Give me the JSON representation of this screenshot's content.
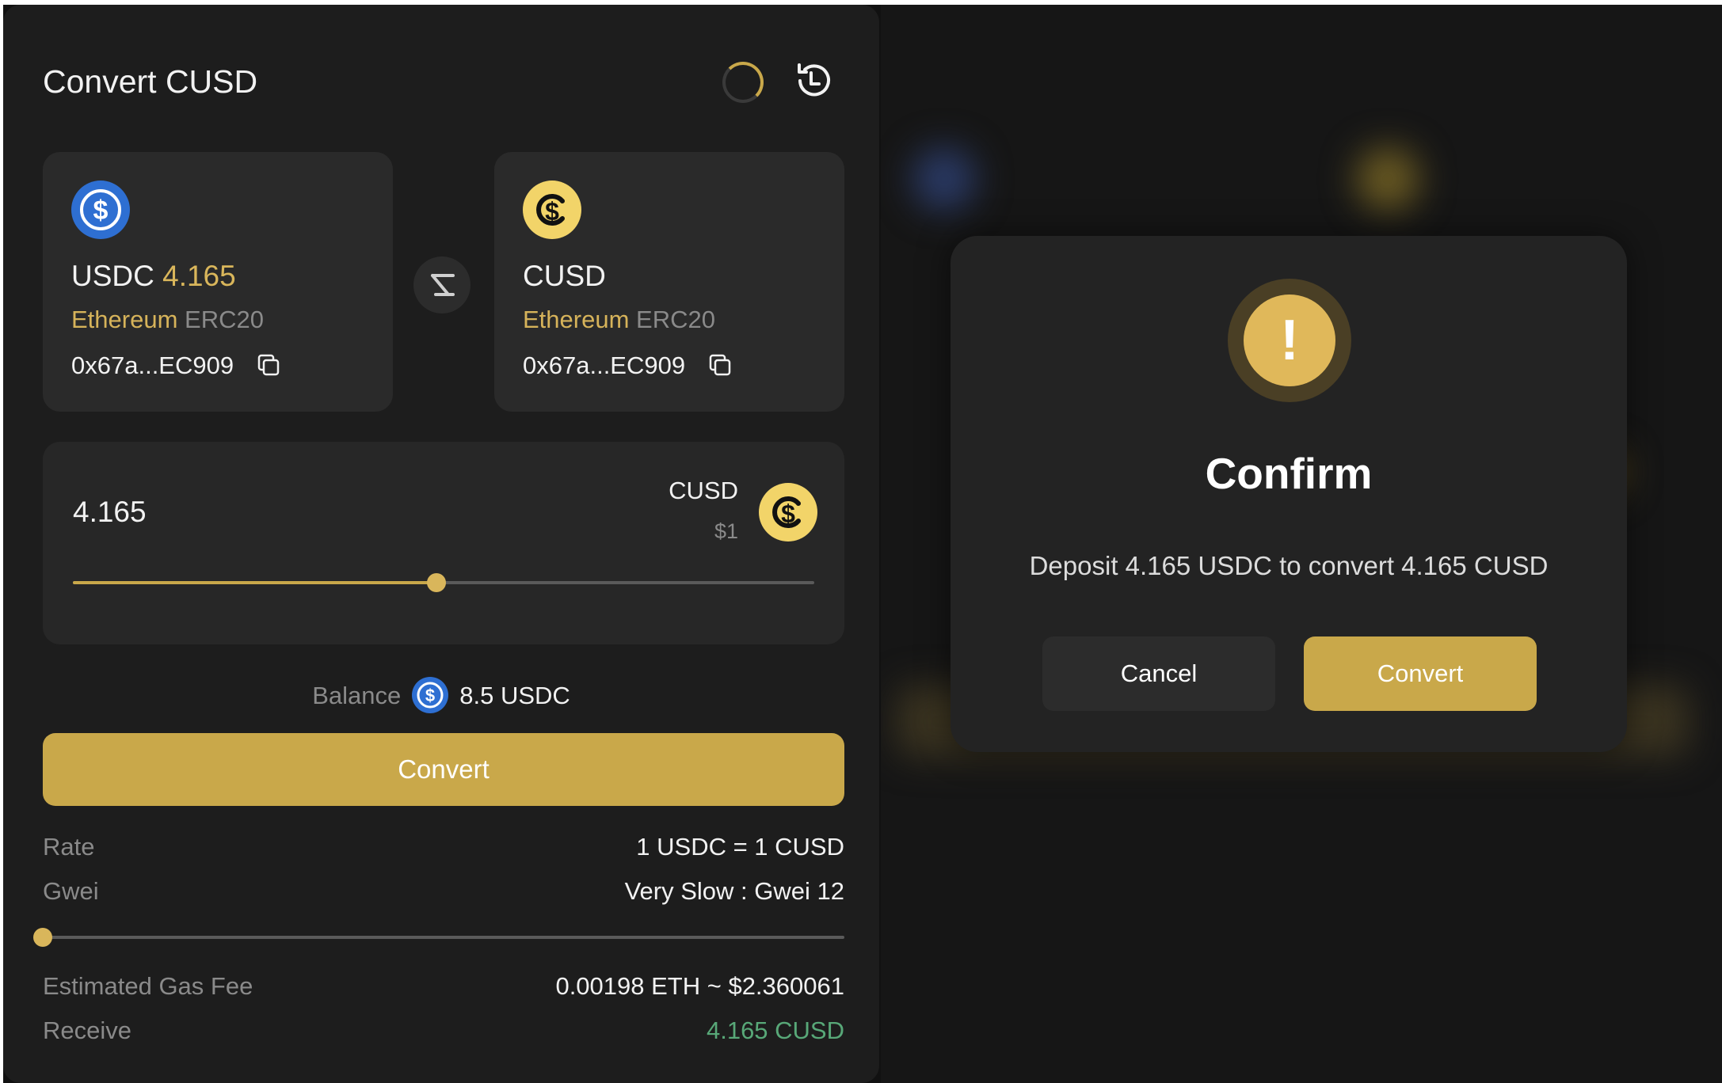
{
  "panel": {
    "title": "Convert CUSD",
    "source": {
      "symbol": "USDC",
      "amount": "4.165",
      "network": "Ethereum",
      "standard": "ERC20",
      "address": "0x67a...EC909",
      "icon": "usdc-dollar-icon"
    },
    "target": {
      "symbol": "CUSD",
      "network": "Ethereum",
      "standard": "ERC20",
      "address": "0x67a...EC909",
      "icon": "cusd-dollar-icon"
    },
    "amount_input": {
      "value": "4.165",
      "currency": "CUSD",
      "price": "$1",
      "slider_fraction": 0.49
    },
    "balance": {
      "label": "Balance",
      "value": "8.5",
      "unit": "USDC"
    },
    "convert_label": "Convert",
    "rate": {
      "label": "Rate",
      "value": "1 USDC = 1 CUSD"
    },
    "gwei": {
      "label": "Gwei",
      "value": "Very Slow : Gwei 12",
      "slider_fraction": 0
    },
    "gas_fee": {
      "label": "Estimated Gas Fee",
      "value": "0.00198 ETH ~ $2.360061"
    },
    "receive": {
      "label": "Receive",
      "value": "4.165 CUSD"
    }
  },
  "modal": {
    "icon": "exclamation-icon",
    "title": "Confirm",
    "message": "Deposit 4.165 USDC to convert 4.165 CUSD",
    "cancel_label": "Cancel",
    "confirm_label": "Convert"
  },
  "colors": {
    "accent": "#c9a84a",
    "usdc_blue": "#2e6fd2",
    "cusd_yellow": "#f2d469",
    "receive_green": "#58a878"
  }
}
